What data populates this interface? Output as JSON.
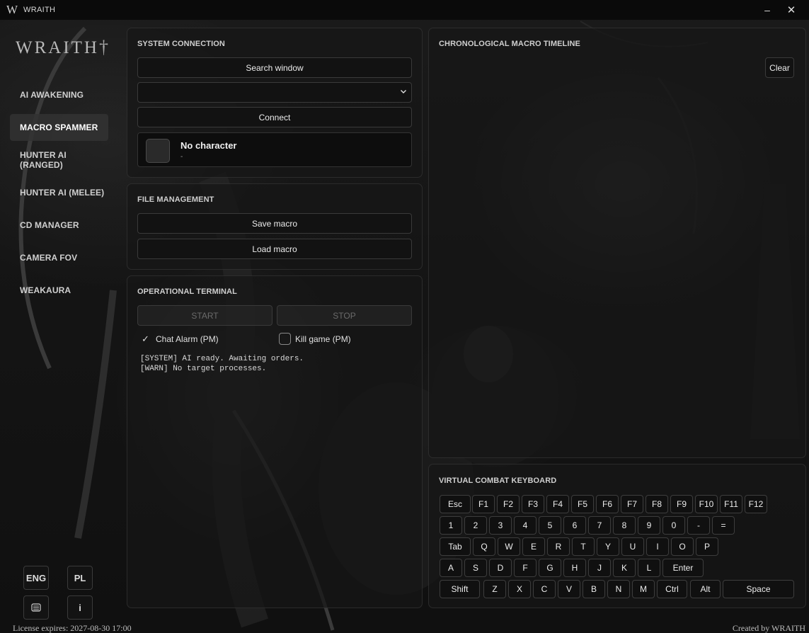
{
  "titlebar": {
    "glyph": "W",
    "title": "WRAITH",
    "minimize": "–",
    "close": "✕"
  },
  "sidebar": {
    "logo": "WRAITH",
    "logo_mark": "†",
    "items": [
      {
        "label": "AI AWAKENING"
      },
      {
        "label": "MACRO SPAMMER",
        "active": true
      },
      {
        "label": "HUNTER AI (RANGED)"
      },
      {
        "label": "HUNTER AI (MELEE)"
      },
      {
        "label": "CD MANAGER"
      },
      {
        "label": "CAMERA FOV"
      },
      {
        "label": "WEAKAURA"
      }
    ],
    "lang_eng": "ENG",
    "lang_pl": "PL",
    "info": "i",
    "license": "License expires: 2027-08-30 17:00",
    "credit": "Created by WRAITH"
  },
  "system": {
    "title": "SYSTEM CONNECTION",
    "search_label": "Search window",
    "select_value": "",
    "connect_label": "Connect",
    "char_name": "No character",
    "char_sub": "-"
  },
  "files": {
    "title": "FILE MANAGEMENT",
    "save_label": "Save macro",
    "load_label": "Load macro"
  },
  "terminal": {
    "title": "OPERATIONAL TERMINAL",
    "start_label": "START",
    "stop_label": "STOP",
    "chat_alarm_label": "Chat Alarm (PM)",
    "chat_alarm_checked": true,
    "kill_game_label": "Kill game (PM)",
    "kill_game_checked": false,
    "log": "[SYSTEM] AI ready. Awaiting orders.\n[WARN] No target processes."
  },
  "timeline": {
    "title": "CHRONOLOGICAL MACRO TIMELINE",
    "clear_label": "Clear"
  },
  "keyboard": {
    "title": "VIRTUAL COMBAT KEYBOARD",
    "rows": [
      [
        "Esc",
        "F1",
        "F2",
        "F3",
        "F4",
        "F5",
        "F6",
        "F7",
        "F8",
        "F9",
        "F10",
        "F11",
        "F12"
      ],
      [
        "1",
        "2",
        "3",
        "4",
        "5",
        "6",
        "7",
        "8",
        "9",
        "0",
        "-",
        "="
      ],
      [
        "Tab",
        "Q",
        "W",
        "E",
        "R",
        "T",
        "Y",
        "U",
        "I",
        "O",
        "P"
      ],
      [
        "A",
        "S",
        "D",
        "F",
        "G",
        "H",
        "J",
        "K",
        "L",
        "Enter"
      ],
      [
        "Shift",
        "Z",
        "X",
        "C",
        "V",
        "B",
        "N",
        "M",
        "Ctrl",
        "Alt",
        "Space"
      ]
    ]
  }
}
